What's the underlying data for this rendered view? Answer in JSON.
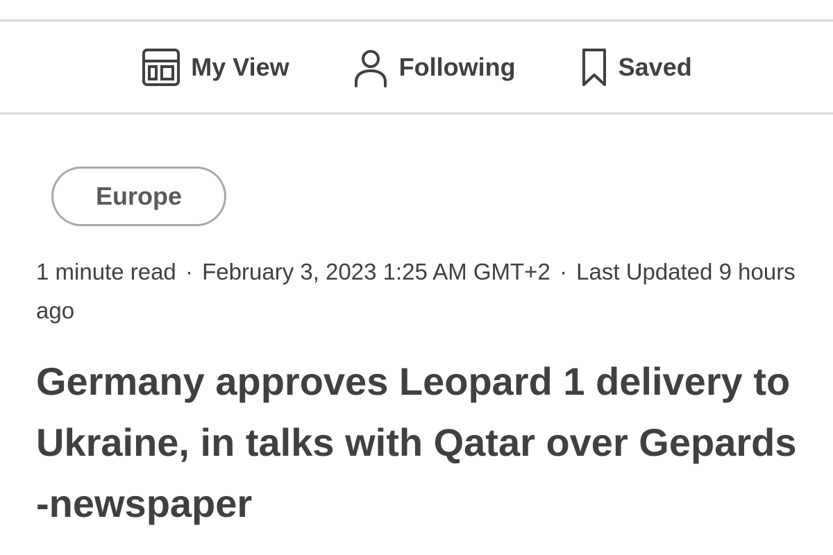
{
  "nav": {
    "items": [
      {
        "label": "My View",
        "icon": "layout-icon"
      },
      {
        "label": "Following",
        "icon": "person-icon"
      },
      {
        "label": "Saved",
        "icon": "bookmark-icon"
      }
    ]
  },
  "article": {
    "category": "Europe",
    "read_time": "1 minute read",
    "separator": "·",
    "published": "February 3, 2023 1:25 AM GMT+2",
    "updated": "Last Updated 9 hours ago",
    "headline": "Germany approves Leopard 1 delivery to Ukraine, in talks with Qatar over Gepards -newspaper"
  },
  "colors": {
    "text": "#404040",
    "rule": "#d6d6d6",
    "tag_border": "#a8a8a8",
    "background": "#ffffff"
  }
}
